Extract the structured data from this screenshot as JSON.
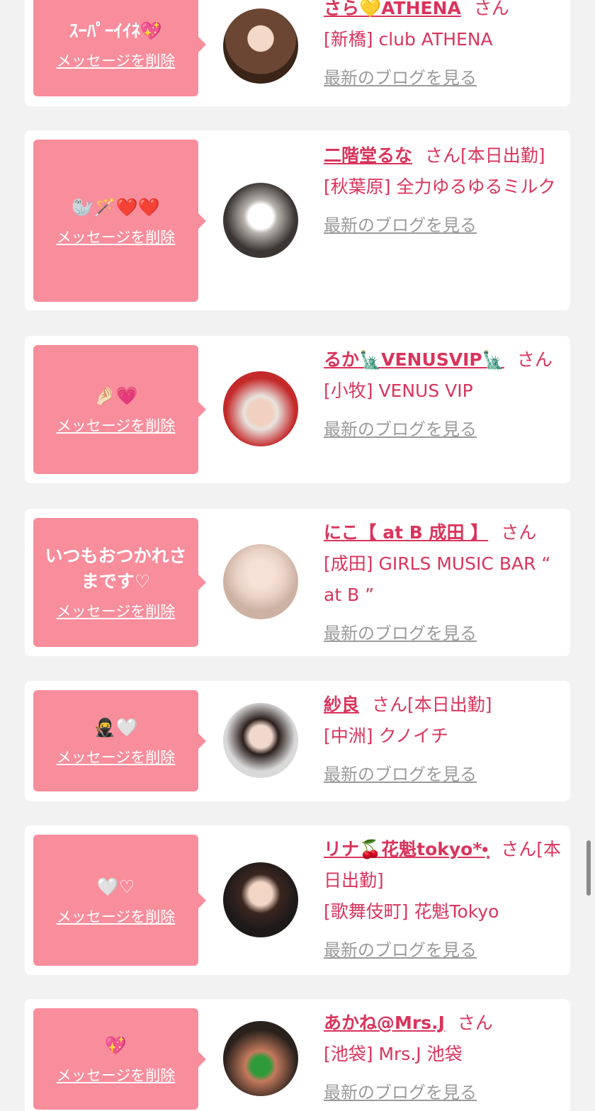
{
  "delete_label": "メッセージを削除",
  "blog_label": "最新のブログを見る",
  "san_label": "さん",
  "colors": {
    "bubble": "#f88d9c",
    "name": "#d9345c",
    "blog": "#9a9a9a",
    "background": "#f2f2f2"
  },
  "entries": [
    {
      "message": "ｽｰﾊﾟｰｲｲﾈ💖",
      "name": "さら💛ATHENA",
      "suffix": "",
      "shop": "[新橋] club ATHENA"
    },
    {
      "message": "🦭🪄❤️❤️",
      "name": "二階堂るな",
      "suffix": "[本日出勤]",
      "shop": "[秋葉原] 全力ゆるゆるミルク"
    },
    {
      "message": "🤌🏻💗",
      "name": "るか🗽VENUSVIP🗽",
      "suffix": "",
      "shop": "[小牧] VENUS VIP"
    },
    {
      "message": "いつもおつかれさまです♡",
      "name": "にこ【 at B 成田 】",
      "suffix": "",
      "shop": "[成田] GIRLS MUSIC BAR “ at B ”"
    },
    {
      "message": "🥷🤍",
      "name": "紗良",
      "suffix": "[本日出勤]",
      "shop": "[中洲] クノイチ"
    },
    {
      "message": "🤍♡",
      "name": "リナ🍒花魁tokyo*•̩̩͙",
      "suffix": "[本日出勤]",
      "shop": "[歌舞伎町] 花魁Tokyo"
    },
    {
      "message": "💖",
      "name": "あかね@Mrs.J",
      "suffix": "",
      "shop": "[池袋] Mrs.J 池袋"
    }
  ]
}
